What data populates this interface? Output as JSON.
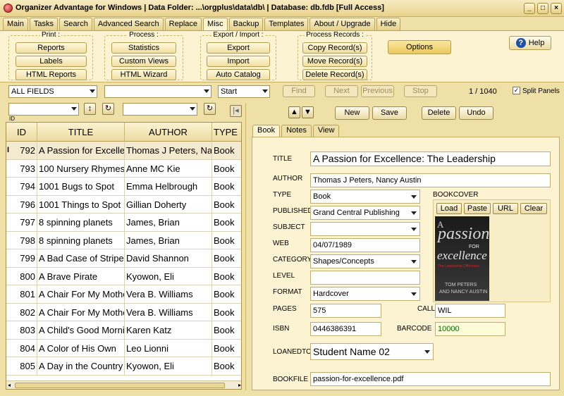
{
  "window": {
    "title": "Organizer Advantage for Windows | Data Folder: ...\\orgplus\\data\\db\\ | Database: db.fdb [Full Access]"
  },
  "menu_tabs": [
    "Main",
    "Tasks",
    "Search",
    "Advanced Search",
    "Replace",
    "Misc",
    "Backup",
    "Templates",
    "About / Upgrade",
    "Hide"
  ],
  "ribbon": {
    "print": {
      "label": "Print :",
      "buttons": [
        "Reports",
        "Labels",
        "HTML Reports"
      ]
    },
    "process": {
      "label": "Process :",
      "buttons": [
        "Statistics",
        "Custom Views",
        "HTML Wizard"
      ]
    },
    "export_import": {
      "label": "Export / Import :",
      "buttons": [
        "Export",
        "Import",
        "Auto Catalog"
      ]
    },
    "process_records": {
      "label": "Process Records :",
      "buttons": [
        "Copy Record(s)",
        "Move Record(s)",
        "Delete Record(s)"
      ]
    },
    "options": "Options",
    "help": "Help"
  },
  "filter": {
    "field": "ALL FIELDS",
    "value": "",
    "mode": "Start",
    "find": "Find",
    "next": "Next",
    "previous": "Previous",
    "stop": "Stop",
    "record_counter": "1 / 1040",
    "split_panels": "Split Panels"
  },
  "sort": {
    "label": "ID"
  },
  "record_nav": {
    "new": "New",
    "save": "Save",
    "delete": "Delete",
    "undo": "Undo"
  },
  "grid": {
    "columns": [
      "ID",
      "TITLE",
      "AUTHOR",
      "TYPE"
    ],
    "rows": [
      [
        "792",
        "A Passion for Excellence",
        "Thomas J Peters, Nancy Austin",
        "Book"
      ],
      [
        "793",
        "100 Nursery Rhymes",
        "Anne MC Kie",
        "Book"
      ],
      [
        "794",
        "1001 Bugs to Spot",
        "Emma Helbrough",
        "Book"
      ],
      [
        "796",
        "1001 Things to Spot",
        "Gillian Doherty",
        "Book"
      ],
      [
        "797",
        "8 spinning planets",
        "James, Brian",
        "Book"
      ],
      [
        "798",
        "8 spinning planets",
        "James, Brian",
        "Book"
      ],
      [
        "799",
        "A Bad Case of Stripes",
        "David Shannon",
        "Book"
      ],
      [
        "800",
        "A Brave Pirate",
        "Kyowon, Eli",
        "Book"
      ],
      [
        "801",
        "A Chair For My Mother",
        "Vera B. Williams",
        "Book"
      ],
      [
        "802",
        "A Chair For My Mother",
        "Vera B. Williams",
        "Book"
      ],
      [
        "803",
        "A Child's Good Morning",
        "Karen Katz",
        "Book"
      ],
      [
        "804",
        "A Color of His Own",
        "Leo Lionni",
        "Book"
      ],
      [
        "805",
        "A Day in the Country",
        "Kyowon, Eli",
        "Book"
      ]
    ]
  },
  "detail_tabs": [
    "Book",
    "Notes",
    "View"
  ],
  "record": {
    "title_label": "TITLE",
    "title": "A Passion for Excellence: The Leadership",
    "author_label": "AUTHOR",
    "author": "Thomas J Peters, Nancy Austin",
    "type_label": "TYPE",
    "type": "Book",
    "published_label": "PUBLISHED",
    "published": "Grand Central Publishing",
    "subject_label": "SUBJECT",
    "subject": "",
    "web_label": "WEB",
    "web": "04/07/1989",
    "category_label": "CATEGORY",
    "category": "Shapes/Concepts",
    "level_label": "LEVEL",
    "level": "",
    "format_label": "FORMAT",
    "format": "Hardcover",
    "pages_label": "PAGES",
    "pages": "575",
    "call_label": "CALL",
    "call": "WIL",
    "isbn_label": "ISBN",
    "isbn": "0446386391",
    "barcode_label": "BARCODE",
    "barcode": "10000",
    "loanedto_label": "LOANEDTO",
    "loanedto": "Student Name 02",
    "bookfile_label": "BOOKFILE",
    "bookfile": "passion-for-excellence.pdf",
    "bookcover_label": "BOOKCOVER"
  },
  "cover_buttons": [
    "Load",
    "Paste",
    "URL",
    "Clear"
  ],
  "cover_art": {
    "line1": "A",
    "line2": "passion",
    "line3": "FOR",
    "line4": "excellence",
    "subtitle": "The Leadership Difference",
    "author1": "TOM PETERS",
    "author2": "AND NANCY AUSTIN"
  }
}
